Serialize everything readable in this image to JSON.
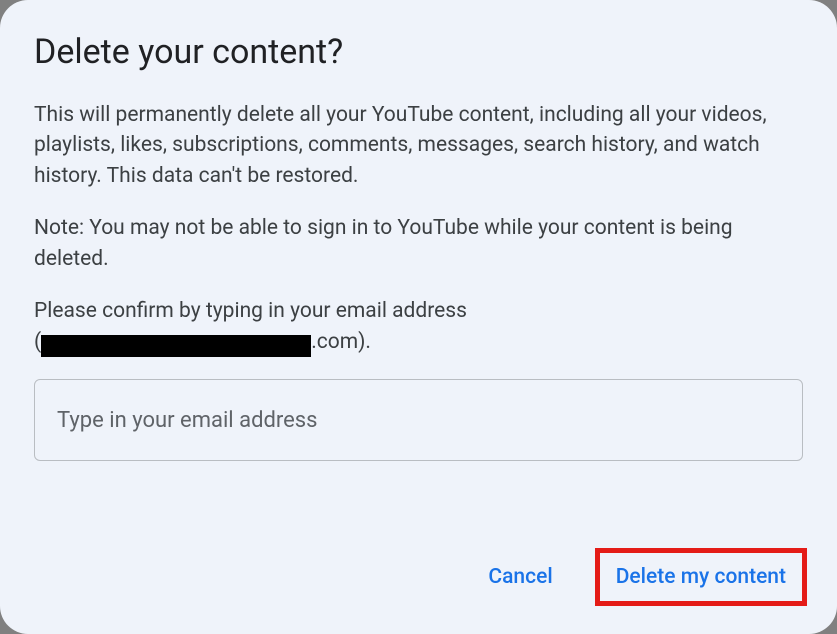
{
  "dialog": {
    "title": "Delete your content?",
    "paragraph1": "This will permanently delete all your YouTube content, including all your videos, playlists, likes, subscriptions, comments, messages, search history, and watch history. This data can't be restored.",
    "paragraph2": "Note: You may not be able to sign in to YouTube while your content is being deleted.",
    "confirm_prefix": "Please confirm by typing in your email address",
    "confirm_open_paren": "(",
    "confirm_email_domain": ".com",
    "confirm_close": ").",
    "input": {
      "placeholder": "Type in your email address",
      "value": ""
    },
    "actions": {
      "cancel": "Cancel",
      "delete": "Delete my content"
    }
  },
  "annotation": {
    "highlight_target": "delete-button",
    "highlight_color": "#e41b17"
  }
}
